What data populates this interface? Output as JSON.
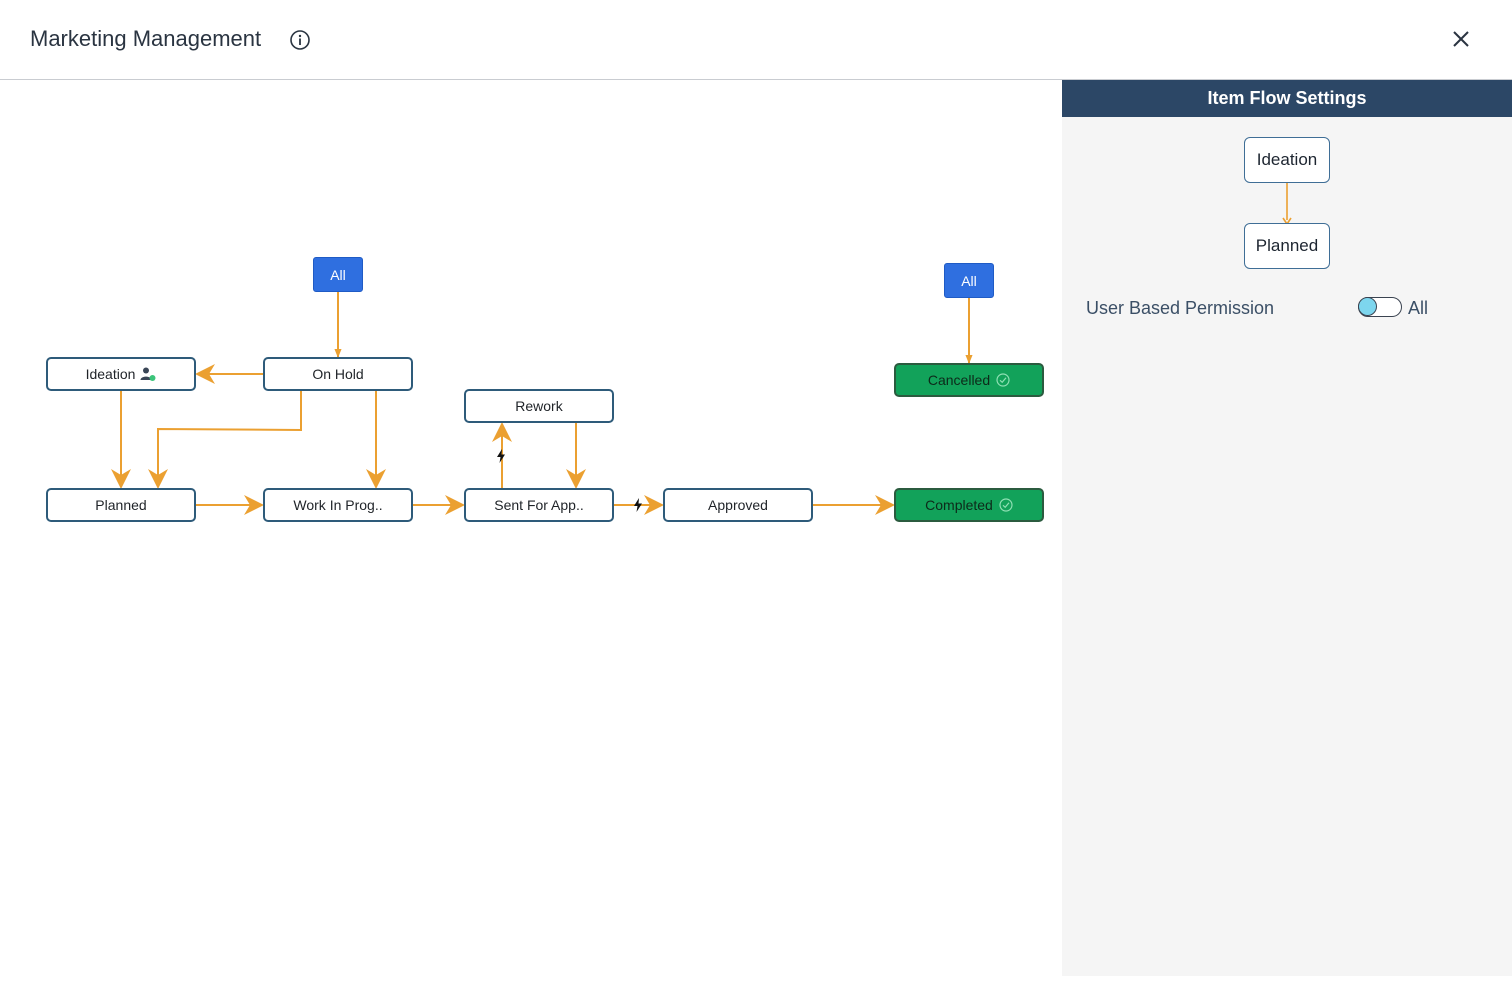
{
  "header": {
    "title": "Marketing Management"
  },
  "flow": {
    "all_left": "All",
    "all_right": "All",
    "nodes": {
      "ideation": "Ideation",
      "on_hold": "On Hold",
      "rework": "Rework",
      "cancelled": "Cancelled",
      "planned": "Planned",
      "work_in_progress": "Work In Prog..",
      "sent_for_approval": "Sent For App..",
      "approved": "Approved",
      "completed": "Completed"
    }
  },
  "panel": {
    "title": "Item Flow Settings",
    "from_state": "Ideation",
    "to_state": "Planned",
    "permission_label": "User Based Permission",
    "permission_toggle_label": "All"
  },
  "colors": {
    "arrow": "#eba031",
    "node_border": "#2e5b7a",
    "done_fill": "#12a25a",
    "all_button": "#2f6fe0",
    "panel_header": "#2c4766"
  }
}
